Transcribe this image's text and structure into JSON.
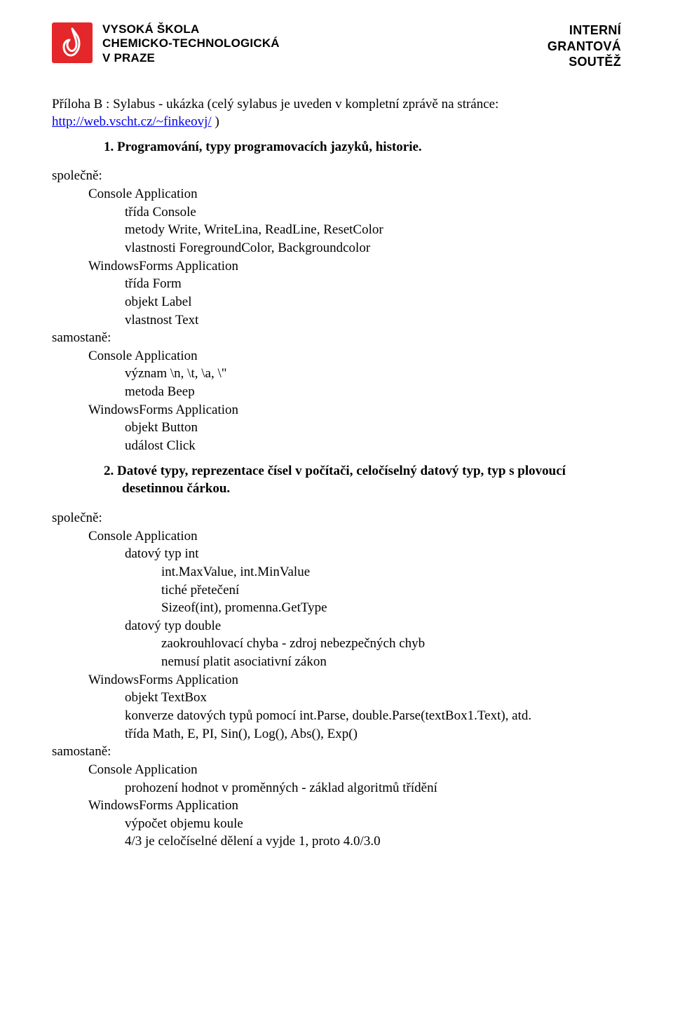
{
  "header": {
    "brand_line1": "VYSOKÁ ŠKOLA",
    "brand_line2": "CHEMICKO-TECHNOLOGICKÁ",
    "brand_line3": "V PRAZE",
    "right_line1": "INTERNÍ",
    "right_line2": "GRANTOVÁ",
    "right_line3": "SOUTĚŽ"
  },
  "intro": {
    "text_before_link": "Příloha B : Sylabus - ukázka (celý sylabus je uveden v kompletní zprávě na stránce: ",
    "link_text": "http://web.vscht.cz/~finkeovj/",
    "text_after_link": " )"
  },
  "sections": [
    {
      "title": "1.  Programování, typy programovacích jazyků, historie.",
      "blocks": [
        {
          "label": "společně:",
          "lines": [
            {
              "lvl": 1,
              "text": "Console Application"
            },
            {
              "lvl": 2,
              "text": "třída Console"
            },
            {
              "lvl": 2,
              "text": "metody Write, WriteLina, ReadLine, ResetColor"
            },
            {
              "lvl": 2,
              "text": "vlastnosti ForegroundColor, Backgroundcolor"
            },
            {
              "lvl": 1,
              "text": "WindowsForms Application"
            },
            {
              "lvl": 2,
              "text": "třída Form"
            },
            {
              "lvl": 2,
              "text": "objekt Label"
            },
            {
              "lvl": 2,
              "text": "vlastnost Text"
            }
          ]
        },
        {
          "label": "samostaně:",
          "lines": [
            {
              "lvl": 1,
              "text": "Console Application"
            },
            {
              "lvl": 2,
              "text": "význam \\n, \\t, \\a, \\\""
            },
            {
              "lvl": 2,
              "text": "metoda Beep"
            },
            {
              "lvl": 1,
              "text": "WindowsForms Application"
            },
            {
              "lvl": 2,
              "text": "objekt Button"
            },
            {
              "lvl": 2,
              "text": "událost Click"
            }
          ]
        }
      ]
    },
    {
      "title": "2.  Datové typy, reprezentace čísel v počítači, celočíselný datový typ, typ s plovoucí desetinnou čárkou.",
      "blocks": [
        {
          "label": "společně:",
          "lines": [
            {
              "lvl": 1,
              "text": "Console Application"
            },
            {
              "lvl": 2,
              "text": "datový typ int"
            },
            {
              "lvl": 3,
              "text": "int.MaxValue, int.MinValue"
            },
            {
              "lvl": 3,
              "text": "tiché přetečení"
            },
            {
              "lvl": 3,
              "text": "Sizeof(int), promenna.GetType"
            },
            {
              "lvl": 2,
              "text": "datový typ double"
            },
            {
              "lvl": 3,
              "text": "zaokrouhlovací chyba - zdroj nebezpečných chyb"
            },
            {
              "lvl": 3,
              "text": "nemusí platit asociativní zákon"
            },
            {
              "lvl": 1,
              "text": "WindowsForms Application"
            },
            {
              "lvl": 2,
              "text": "objekt TextBox"
            },
            {
              "lvl": 2,
              "text": "konverze datových typů pomocí int.Parse, double.Parse(textBox1.Text), atd."
            },
            {
              "lvl": 2,
              "text": "třída Math, E, PI, Sin(), Log(), Abs(), Exp()"
            }
          ]
        },
        {
          "label": "samostaně:",
          "lines": [
            {
              "lvl": 1,
              "text": "Console Application"
            },
            {
              "lvl": 2,
              "text": "prohození hodnot v proměnných - základ algoritmů třídění"
            },
            {
              "lvl": 1,
              "text": "WindowsForms Application"
            },
            {
              "lvl": 2,
              "text": "výpočet objemu koule"
            },
            {
              "lvl": 2,
              "text": "4/3 je celočíselné dělení a vyjde 1, proto 4.0/3.0"
            }
          ]
        }
      ]
    }
  ]
}
